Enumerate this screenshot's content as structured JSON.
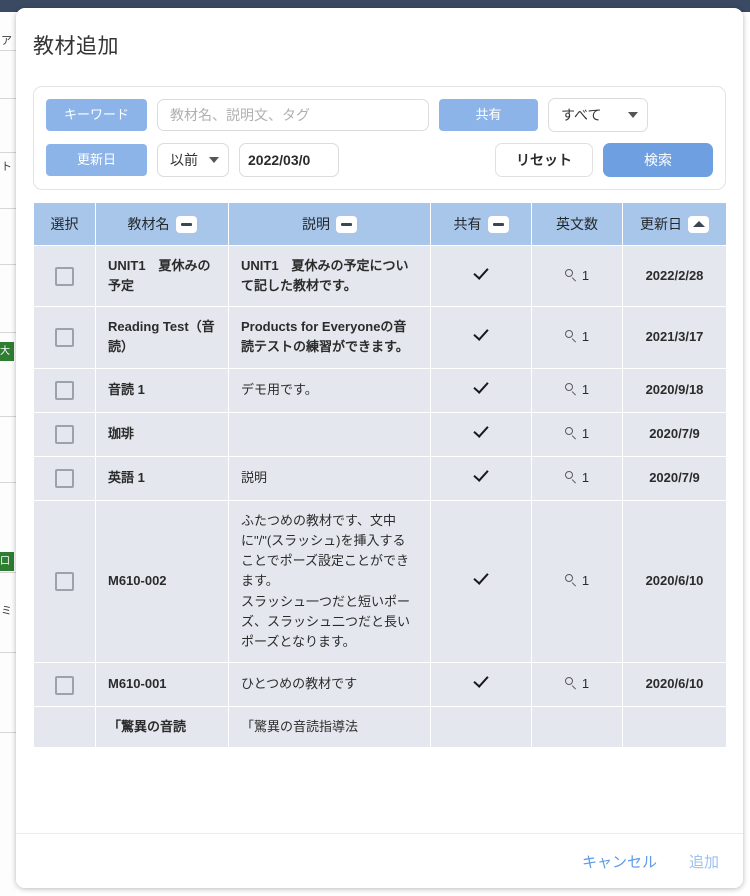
{
  "dialog": {
    "title": "教材追加"
  },
  "search": {
    "keyword_label": "キーワード",
    "keyword_placeholder": "教材名、説明文、タグ",
    "share_label": "共有",
    "share_value": "すべて",
    "date_label": "更新日",
    "date_compare": "以前",
    "date_value": "2022/03/0",
    "reset_label": "リセット",
    "search_label": "検索"
  },
  "table": {
    "columns": [
      {
        "label": "選択",
        "sort": "none"
      },
      {
        "label": "教材名",
        "sort": "dash"
      },
      {
        "label": "説明",
        "sort": "dash"
      },
      {
        "label": "共有",
        "sort": "dash"
      },
      {
        "label": "英文数",
        "sort": "none"
      },
      {
        "label": "更新日",
        "sort": "asc"
      }
    ],
    "rows": [
      {
        "name": "UNIT1　夏休みの予定",
        "desc": "UNIT1　夏休みの予定について記した教材です。",
        "desc_bold": true,
        "shared": true,
        "count": "1",
        "date": "2022/2/28"
      },
      {
        "name": "Reading Test（音読）",
        "desc": "Products for Everyoneの音読テストの練習ができます。",
        "desc_bold": true,
        "shared": true,
        "count": "1",
        "date": "2021/3/17"
      },
      {
        "name": "音読 1",
        "desc": "デモ用です。",
        "desc_bold": false,
        "shared": true,
        "count": "1",
        "date": "2020/9/18"
      },
      {
        "name": "珈琲",
        "desc": "",
        "desc_bold": false,
        "shared": true,
        "count": "1",
        "date": "2020/7/9"
      },
      {
        "name": "英語 1",
        "desc": "説明",
        "desc_bold": false,
        "shared": true,
        "count": "1",
        "date": "2020/7/9"
      },
      {
        "name": "M610-002",
        "desc": "ふたつめの教材です、文中に\"/\"(スラッシュ)を挿入することでポーズ設定ことができます。\nスラッシュ一つだと短いポーズ、スラッシュ二つだと長いポーズとなります。",
        "desc_bold": false,
        "shared": true,
        "count": "1",
        "date": "2020/6/10"
      },
      {
        "name": "M610-001",
        "desc": "ひとつめの教材です",
        "desc_bold": false,
        "shared": true,
        "count": "1",
        "date": "2020/6/10"
      },
      {
        "name": "「驚異の音読",
        "desc": "「驚異の音読指導法",
        "desc_bold": false,
        "shared": false,
        "count": "",
        "date": ""
      }
    ]
  },
  "footer": {
    "cancel_label": "キャンセル",
    "add_label": "追加"
  }
}
